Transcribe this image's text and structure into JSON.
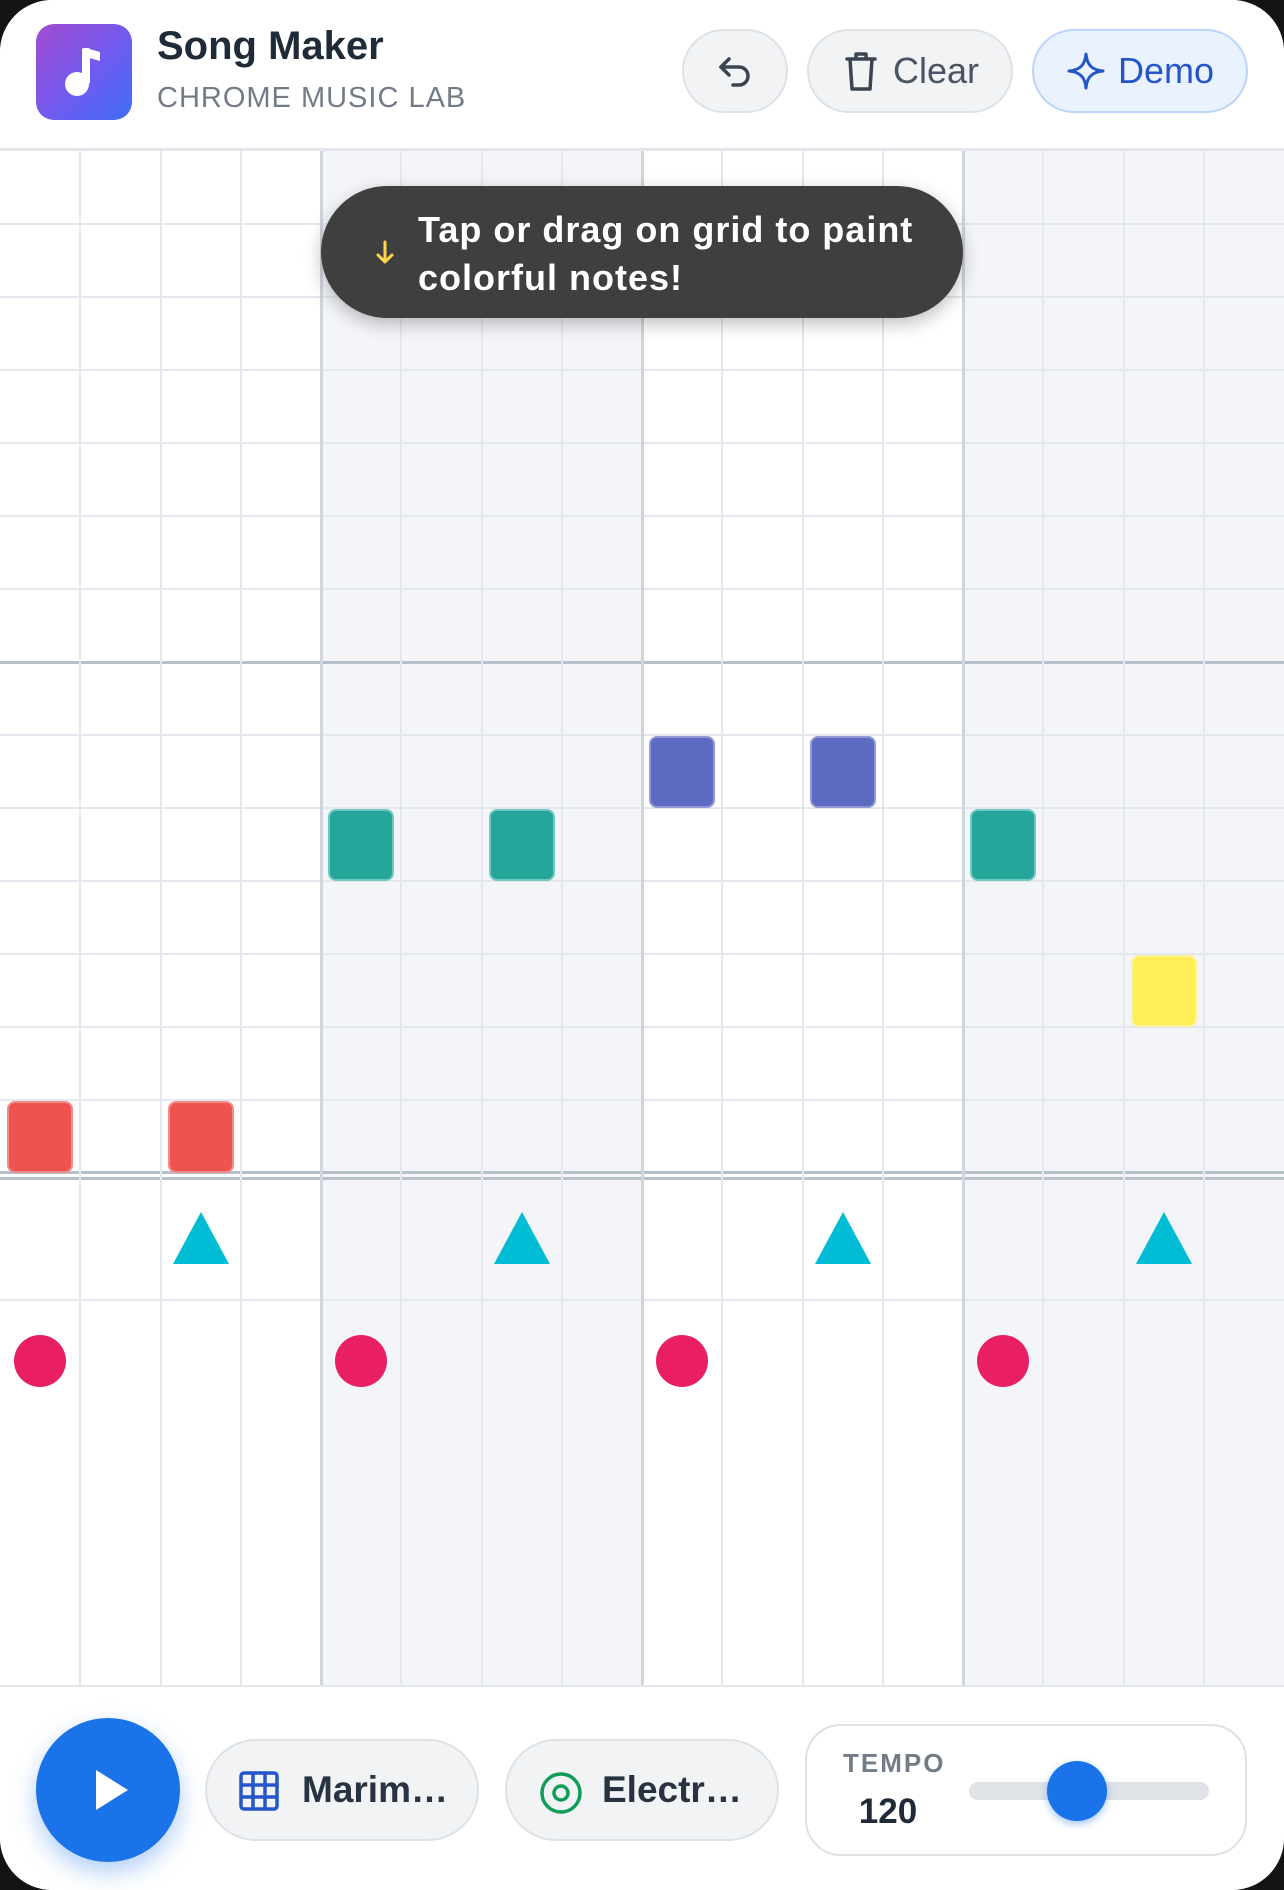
{
  "header": {
    "title": "Song Maker",
    "subtitle": "CHROME MUSIC LAB",
    "buttons": {
      "clear_label": "Clear",
      "demo_label": "Demo"
    }
  },
  "tooltip": {
    "text": "Tap or drag on grid to paint colorful notes!"
  },
  "grid": {
    "columns": 16,
    "melody_rows": 14,
    "beats_per_bar": 4,
    "colors": {
      "red": "#ef5350",
      "teal": "#26a69a",
      "indigo": "#5c6bc0",
      "yellow": "#ffee58",
      "percussion_triangle": "#00bcd4",
      "percussion_circle": "#e91e63"
    },
    "notes": [
      {
        "col": 0,
        "row": 13,
        "color": "red"
      },
      {
        "col": 2,
        "row": 13,
        "color": "red"
      },
      {
        "col": 4,
        "row": 9,
        "color": "teal"
      },
      {
        "col": 6,
        "row": 9,
        "color": "teal"
      },
      {
        "col": 8,
        "row": 8,
        "color": "indigo"
      },
      {
        "col": 10,
        "row": 8,
        "color": "indigo"
      },
      {
        "col": 12,
        "row": 9,
        "color": "teal"
      },
      {
        "col": 14,
        "row": 11,
        "color": "yellow"
      }
    ],
    "percussion": {
      "triangles": [
        2,
        6,
        10,
        14
      ],
      "circles": [
        0,
        4,
        8,
        12
      ]
    }
  },
  "controls": {
    "instrument_label": "Marimba",
    "percussion_label": "Electronic",
    "tempo_label": "TEMPO",
    "tempo_value": "120",
    "tempo_fraction": 0.45
  }
}
